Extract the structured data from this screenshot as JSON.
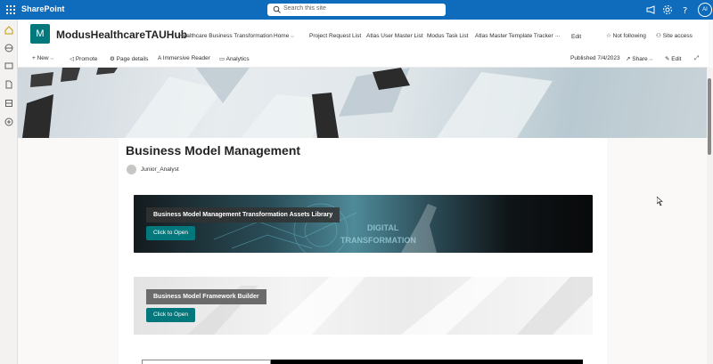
{
  "suite": {
    "brand": "SharePoint",
    "search_placeholder": "Search this site",
    "avatar_initials": "AI"
  },
  "site": {
    "logo_letter": "M",
    "name": "ModusHealthcareTAUHub",
    "nav": [
      "Healthcare Business Transformation",
      "Home",
      "Project Request List",
      "Atlas User Master List",
      "Modus Task List",
      "Atlas Master Template Tracker",
      "...",
      "Edit"
    ],
    "following": "Not following",
    "access": "Site access"
  },
  "commands": {
    "new": "New",
    "promote": "Promote",
    "page_details": "Page details",
    "immersive_reader": "Immersive Reader",
    "analytics": "Analytics",
    "published": "Published 7/4/2023",
    "share": "Share",
    "edit": "Edit"
  },
  "page": {
    "title": "Business Model Management",
    "author": "Junior_Analyst"
  },
  "cards": [
    {
      "title": "Business Model Management Transformation Assets Library",
      "button": "Click to Open",
      "image_text": "DIGITAL TRANSFORMATION"
    },
    {
      "title": "Business Model Framework Builder",
      "button": "Click to Open"
    }
  ],
  "colors": {
    "suite_bar": "#0f6cbd",
    "accent": "#03787c"
  }
}
